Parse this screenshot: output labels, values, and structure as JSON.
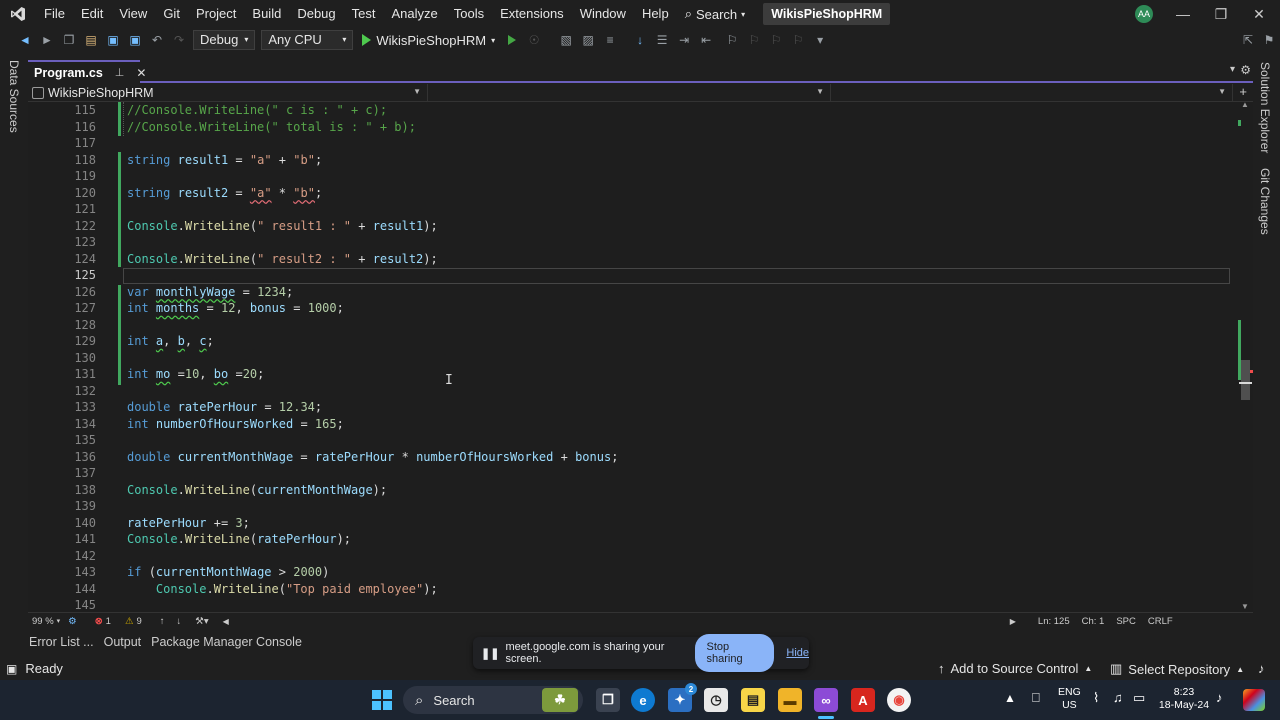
{
  "menubar": {
    "items": [
      "File",
      "Edit",
      "View",
      "Git",
      "Project",
      "Build",
      "Debug",
      "Test",
      "Analyze",
      "Tools",
      "Extensions",
      "Window",
      "Help"
    ],
    "search_label": "Search",
    "solution_title": "WikisPieShopHRM",
    "avatar_initials": "AA"
  },
  "toolbar": {
    "config": "Debug",
    "platform": "Any CPU",
    "run_target": "WikisPieShopHRM"
  },
  "side_panels": {
    "left": "Data Sources",
    "right_top": "Solution Explorer",
    "right_bottom": "Git Changes"
  },
  "tab": {
    "active_file": "Program.cs"
  },
  "navbar": {
    "project": "WikisPieShopHRM"
  },
  "editor": {
    "lines": [
      {
        "n": "115",
        "text": "//Console.WriteLine(\" c is : \" + c);"
      },
      {
        "n": "116",
        "text": "//Console.WriteLine(\" total is : \" + b);"
      },
      {
        "n": "117",
        "text": ""
      },
      {
        "n": "118",
        "text": "string result1 = \"a\" + \"b\";"
      },
      {
        "n": "119",
        "text": ""
      },
      {
        "n": "120",
        "text": "string result2 = \"a\" * \"b\";"
      },
      {
        "n": "121",
        "text": ""
      },
      {
        "n": "122",
        "text": "Console.WriteLine(\" result1 : \" + result1);"
      },
      {
        "n": "123",
        "text": ""
      },
      {
        "n": "124",
        "text": "Console.WriteLine(\" result2 : \" + result2);"
      },
      {
        "n": "125",
        "text": ""
      },
      {
        "n": "126",
        "text": "var monthlyWage = 1234;"
      },
      {
        "n": "127",
        "text": "int months = 12, bonus = 1000;"
      },
      {
        "n": "128",
        "text": ""
      },
      {
        "n": "129",
        "text": "int a, b, c;"
      },
      {
        "n": "130",
        "text": ""
      },
      {
        "n": "131",
        "text": "int mo =10, bo =20;"
      },
      {
        "n": "132",
        "text": ""
      },
      {
        "n": "133",
        "text": "double ratePerHour = 12.34;"
      },
      {
        "n": "134",
        "text": "int numberOfHoursWorked = 165;"
      },
      {
        "n": "135",
        "text": ""
      },
      {
        "n": "136",
        "text": "double currentMonthWage = ratePerHour * numberOfHoursWorked + bonus;"
      },
      {
        "n": "137",
        "text": ""
      },
      {
        "n": "138",
        "text": "Console.WriteLine(currentMonthWage);"
      },
      {
        "n": "139",
        "text": ""
      },
      {
        "n": "140",
        "text": "ratePerHour += 3;"
      },
      {
        "n": "141",
        "text": "Console.WriteLine(ratePerHour);"
      },
      {
        "n": "142",
        "text": ""
      },
      {
        "n": "143",
        "text": "if (currentMonthWage > 2000)"
      },
      {
        "n": "144",
        "text": "    Console.WriteLine(\"Top paid employee\");"
      },
      {
        "n": "145",
        "text": ""
      }
    ]
  },
  "editor_status": {
    "zoom": "99 %",
    "errors": "1",
    "warnings": "9",
    "line": "Ln: 125",
    "col": "Ch: 1",
    "whitespace": "SPC",
    "line_ending": "CRLF"
  },
  "bottom_tabs": [
    "Error List ...",
    "Output",
    "Package Manager Console"
  ],
  "statusbar": {
    "ready": "Ready",
    "source_control": "Add to Source Control",
    "repository": "Select Repository"
  },
  "share_banner": {
    "message": "meet.google.com is sharing your screen.",
    "stop": "Stop sharing",
    "hide": "Hide"
  },
  "taskbar": {
    "search": "Search",
    "lang_top": "ENG",
    "lang_bottom": "US",
    "time": "8:23",
    "date": "18-May-24",
    "badge": "2"
  }
}
